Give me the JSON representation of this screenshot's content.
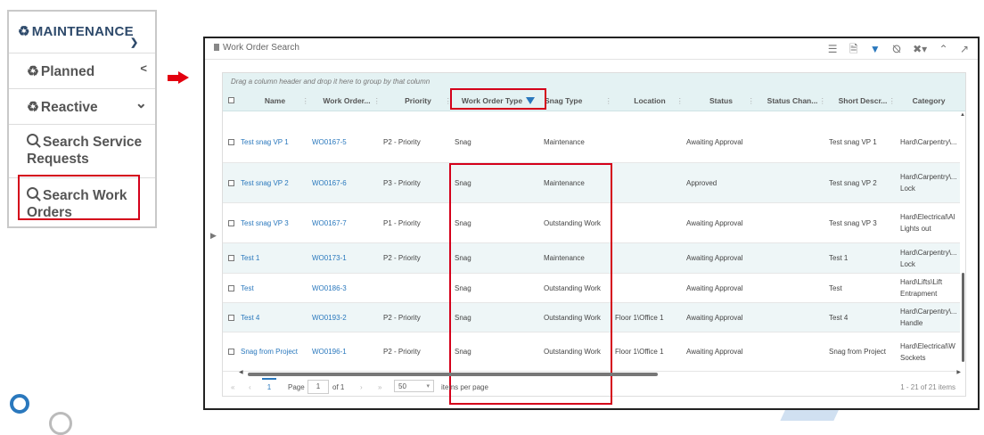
{
  "nav": {
    "title": "MAINTENANCE",
    "items": [
      {
        "label": "Planned",
        "icon": "recycle-icon",
        "chevron": "<"
      },
      {
        "label": "Reactive",
        "icon": "recycle-icon",
        "chevron": "⌄"
      },
      {
        "label": "Search Service Requests",
        "icon": "search-icon"
      },
      {
        "label": "Search Work Orders",
        "icon": "search-icon"
      }
    ]
  },
  "window": {
    "title": "Work Order Search",
    "tools": [
      "list-icon",
      "export-icon",
      "filter-icon",
      "clear-filter-icon",
      "settings-icon",
      "collapse-icon",
      "popout-icon"
    ]
  },
  "grid": {
    "group_hint": "Drag a column header and drop it here to group by that column",
    "columns": [
      "Name",
      "Work Order...",
      "Priority",
      "Work Order Type",
      "Snag Type",
      "Location",
      "Status",
      "Status Chan...",
      "Short Descr...",
      "Category"
    ],
    "rows": [
      {
        "name": "Test snag VP 1",
        "wo": "WO0167-5",
        "priority": "P2 - Priority",
        "type": "Snag",
        "snag": "Maintenance",
        "location": "",
        "status": "Awaiting Approval",
        "status_change": "",
        "short": "Test snag VP 1",
        "category": "Hard\\Carpentry\\..."
      },
      {
        "name": "Test snag VP 2",
        "wo": "WO0167-6",
        "priority": "P3 - Priority",
        "type": "Snag",
        "snag": "Maintenance",
        "location": "",
        "status": "Approved",
        "status_change": "",
        "short": "Test snag VP 2",
        "category": "Hard\\Carpentry\\... Lock"
      },
      {
        "name": "Test snag VP 3",
        "wo": "WO0167-7",
        "priority": "P1 - Priority",
        "type": "Snag",
        "snag": "Outstanding Work",
        "location": "",
        "status": "Awaiting Approval",
        "status_change": "",
        "short": "Test snag VP 3",
        "category": "Hard\\Electrical\\Al Lights out"
      },
      {
        "name": "Test 1",
        "wo": "WO0173-1",
        "priority": "P2 - Priority",
        "type": "Snag",
        "snag": "Maintenance",
        "location": "",
        "status": "Awaiting Approval",
        "status_change": "",
        "short": "Test 1",
        "category": "Hard\\Carpentry\\... Lock"
      },
      {
        "name": "Test",
        "wo": "WO0186-3",
        "priority": "",
        "type": "Snag",
        "snag": "Outstanding Work",
        "location": "",
        "status": "Awaiting Approval",
        "status_change": "",
        "short": "Test",
        "category": "Hard\\Lifts\\Lift Entrapment"
      },
      {
        "name": "Test 4",
        "wo": "WO0193-2",
        "priority": "P2 - Priority",
        "type": "Snag",
        "snag": "Outstanding Work",
        "location": "Floor 1\\Office 1",
        "status": "Awaiting Approval",
        "status_change": "",
        "short": "Test 4",
        "category": "Hard\\Carpentry\\... Handle"
      },
      {
        "name": "Snag from Project",
        "wo": "WO0196-1",
        "priority": "P2 - Priority",
        "type": "Snag",
        "snag": "Outstanding Work",
        "location": "Floor 1\\Office 1",
        "status": "Awaiting Approval",
        "status_change": "",
        "short": "Snag from Project",
        "category": "Hard\\Electrical\\W Sockets"
      }
    ]
  },
  "pager": {
    "current_page": "1",
    "page_label": "Page",
    "page_input": "1",
    "of_label": "of 1",
    "page_size": "50",
    "per_page_label": "items per page",
    "summary": "1 - 21 of 21 items"
  },
  "colors": {
    "accent": "#2a78bd",
    "highlight": "#d4001a",
    "header_bg": "#e4f2f3"
  }
}
